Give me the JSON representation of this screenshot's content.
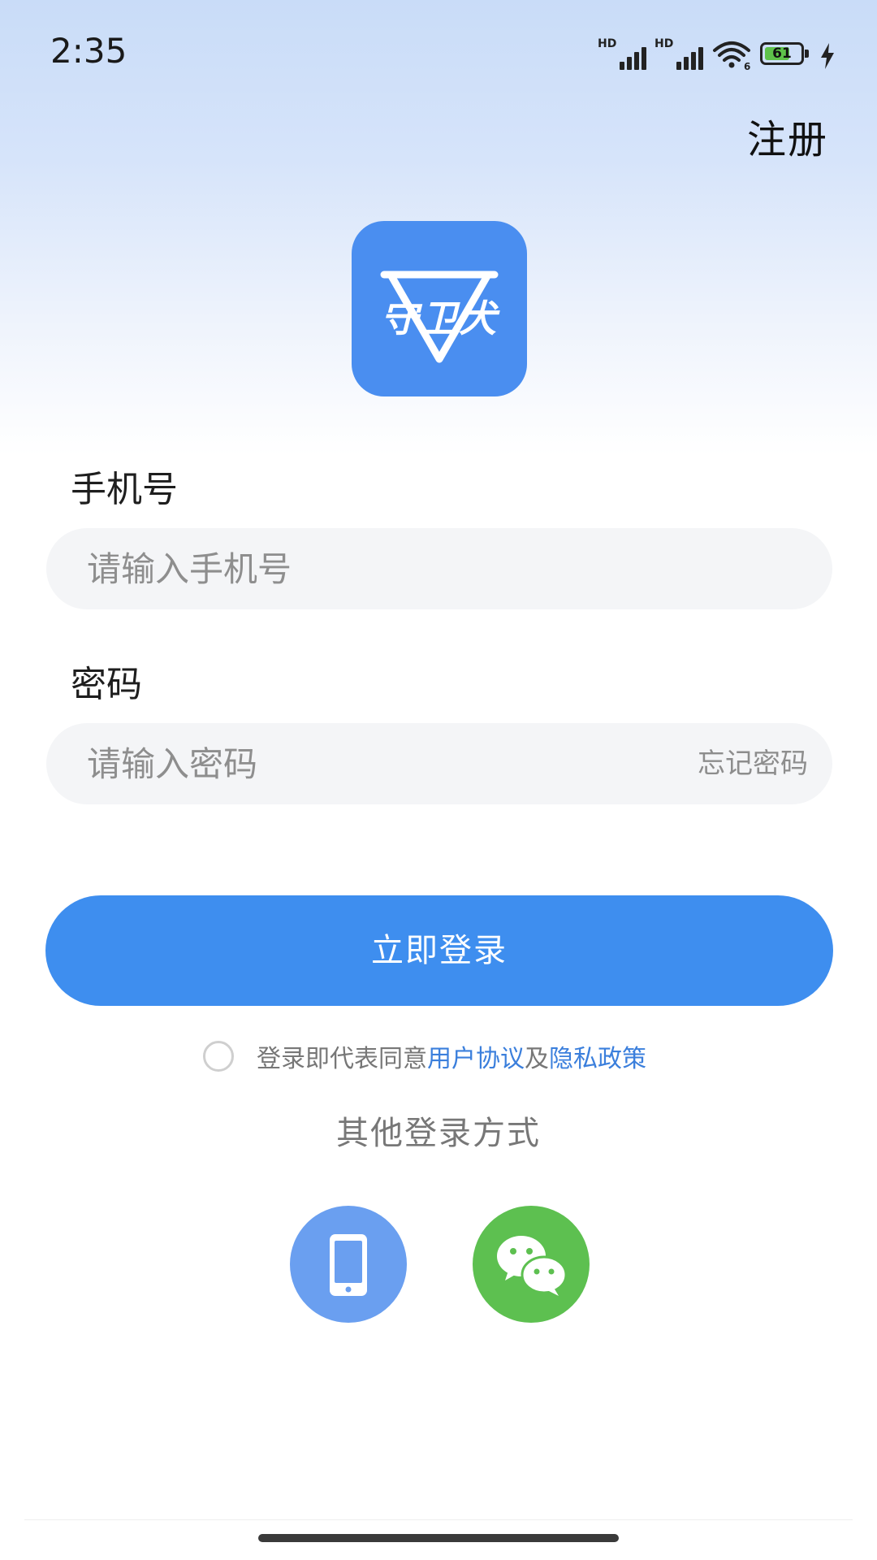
{
  "status_bar": {
    "time": "2:35",
    "sim1_label": "HD",
    "sim2_label": "HD",
    "wifi_badge": "6",
    "battery_level": "61",
    "charging": true
  },
  "header": {
    "register_label": "注册"
  },
  "logo": {
    "text": "守卫犬",
    "background_color": "#4a8ef0"
  },
  "form": {
    "phone": {
      "label": "手机号",
      "placeholder": "请输入手机号",
      "value": ""
    },
    "password": {
      "label": "密码",
      "placeholder": "请输入密码",
      "value": "",
      "forgot_label": "忘记密码"
    }
  },
  "login_button": {
    "label": "立即登录",
    "color": "#3e8eef"
  },
  "agreement": {
    "checked": false,
    "prefix": "登录即代表同意",
    "user_agreement": "用户协议",
    "conjunction": "及",
    "privacy_policy": "隐私政策",
    "link_color": "#3b7fdc"
  },
  "other_login": {
    "title": "其他登录方式",
    "methods": [
      {
        "icon": "mobile-phone-icon",
        "color": "#6a9ff0"
      },
      {
        "icon": "wechat-icon",
        "color": "#5dc050"
      }
    ]
  }
}
